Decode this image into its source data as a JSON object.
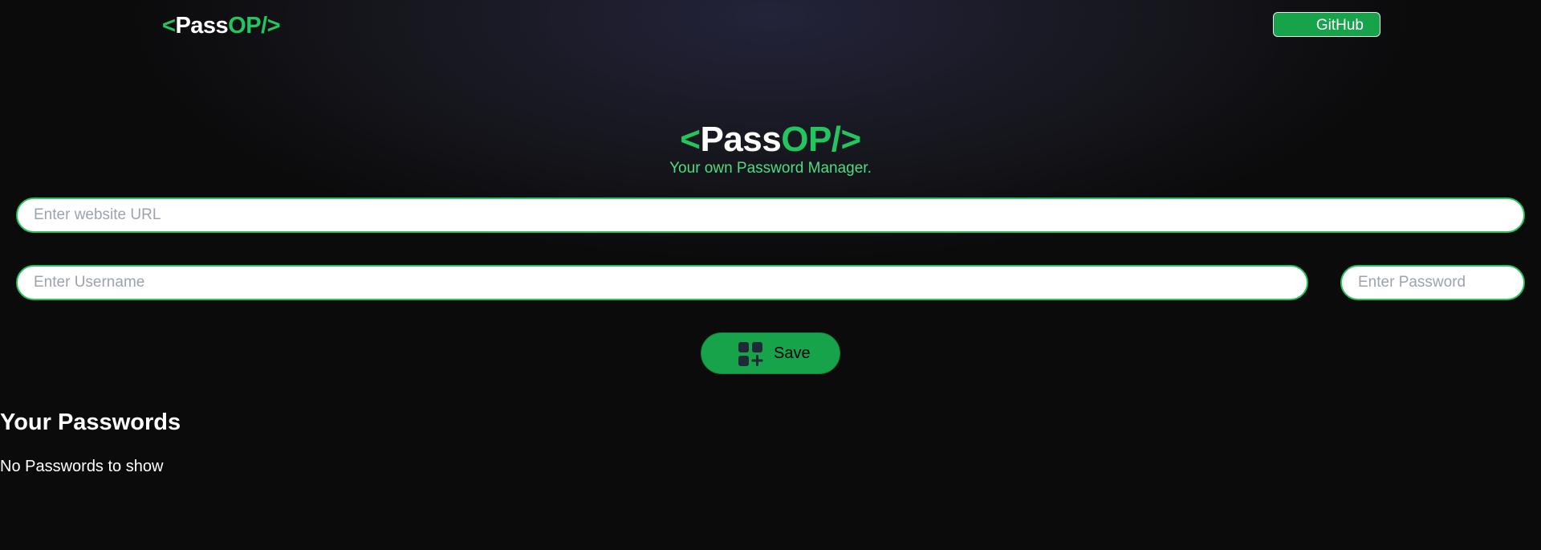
{
  "navbar": {
    "logo": {
      "open": "<",
      "pass": "Pass",
      "op": "OP/",
      "close": ">"
    },
    "github_label": "GitHub"
  },
  "hero": {
    "logo": {
      "open": "<",
      "pass": "Pass",
      "op": "OP/",
      "close": ">"
    },
    "tagline": "Your own Password Manager."
  },
  "form": {
    "url_placeholder": "Enter website URL",
    "url_value": "",
    "username_placeholder": "Enter Username",
    "username_value": "",
    "password_placeholder": "Enter Password",
    "password_value": "",
    "save_label": "Save",
    "save_icon": "add-grid-icon"
  },
  "passwords": {
    "heading": "Your Passwords",
    "empty_message": "No Passwords to show"
  },
  "colors": {
    "accent": "#22c55e",
    "button": "#16a34a",
    "tagline": "#4ade80"
  }
}
